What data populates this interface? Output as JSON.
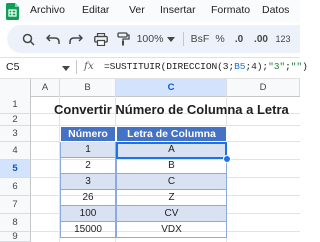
{
  "menu": [
    "Archivo",
    "Editar",
    "Ver",
    "Insertar",
    "Formato",
    "Datos"
  ],
  "toolbar": {
    "zoom": "100%",
    "currency": "BsF",
    "percent": "%",
    "dec_decrease": ".0",
    "dec_increase": ".00",
    "number_format": "123"
  },
  "formula_bar": {
    "name_box": "C5",
    "fx": "fx",
    "formula": {
      "p1": "=SUSTITUIR(DIRECCION(3;",
      "ref": "B5",
      "p2": ";4);",
      "s1": "\"3\"",
      "p3": ";",
      "s2": "\"\"",
      "p4": ")"
    }
  },
  "grid": {
    "columns": [
      "A",
      "B",
      "C",
      "D"
    ],
    "rows": [
      "1",
      "2",
      "3",
      "4",
      "5",
      "6",
      "7",
      "8",
      "9",
      "10"
    ],
    "selected_cell": "C5"
  },
  "table": {
    "title": "Convertir Número de Columna a Letra",
    "headers": [
      "Número",
      "Letra de Columna"
    ],
    "rows": [
      [
        "1",
        "A"
      ],
      [
        "2",
        "B"
      ],
      [
        "3",
        "C"
      ],
      [
        "26",
        "Z"
      ],
      [
        "100",
        "CV"
      ],
      [
        "15000",
        "VDX"
      ]
    ]
  },
  "colors": {
    "header_fill": "#4472c4",
    "band_fill": "#d9e2f3",
    "selection": "#1a73e8",
    "sheets_green": "#0f9d58"
  }
}
